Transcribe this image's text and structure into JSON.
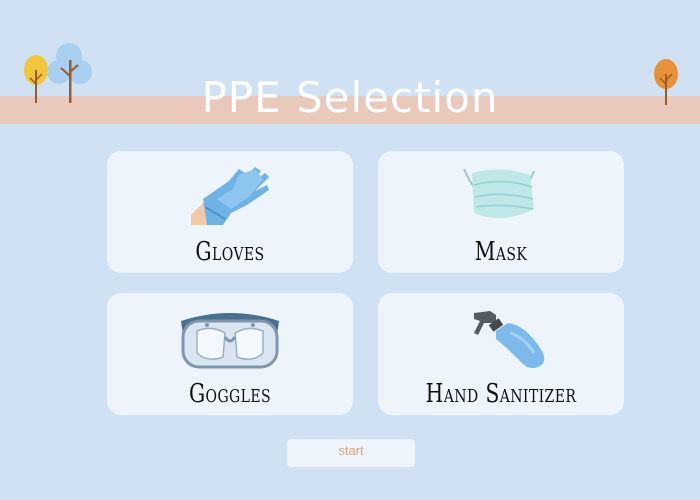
{
  "header": {
    "title": "PPE Selection"
  },
  "items": [
    {
      "label": "Gloves",
      "icon": "gloves-icon"
    },
    {
      "label": "Mask",
      "icon": "mask-icon"
    },
    {
      "label": "Goggles",
      "icon": "goggles-icon"
    },
    {
      "label": "Hand Sanitizer",
      "icon": "spray-bottle-icon"
    }
  ],
  "start_button": {
    "label": "start"
  },
  "colors": {
    "background": "#cfe1f2",
    "banner": "#e9c9bb",
    "card": "#eef4fb",
    "start_text": "#e7a27a"
  }
}
